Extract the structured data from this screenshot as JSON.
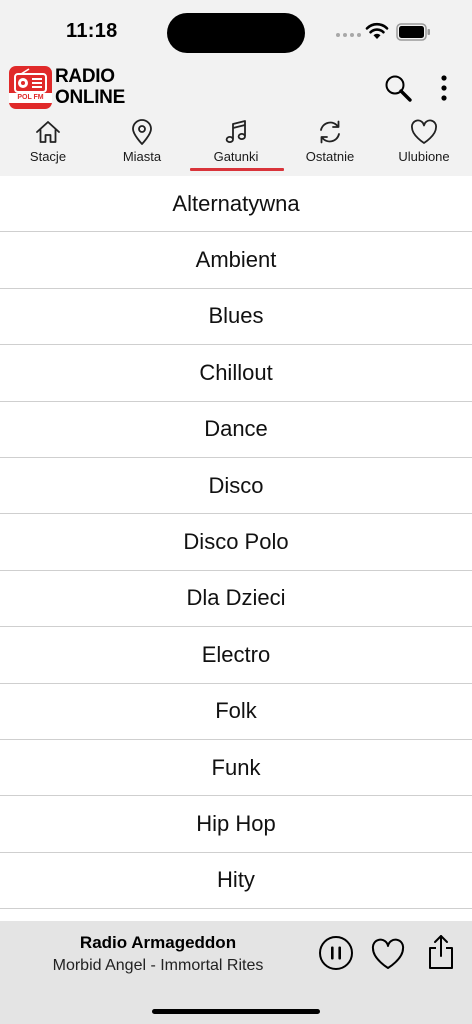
{
  "status_bar": {
    "time": "11:18"
  },
  "header": {
    "logo_line1": "RADIO",
    "logo_line2": "ONLINE",
    "logo_badge": "POL FM",
    "accent_color": "#e02a2a"
  },
  "tabs": [
    {
      "label": "Stacje",
      "icon": "home-icon",
      "active": false
    },
    {
      "label": "Miasta",
      "icon": "location-pin-icon",
      "active": false
    },
    {
      "label": "Gatunki",
      "icon": "music-note-icon",
      "active": true
    },
    {
      "label": "Ostatnie",
      "icon": "refresh-icon",
      "active": false
    },
    {
      "label": "Ulubione",
      "icon": "heart-icon",
      "active": false
    }
  ],
  "genres": [
    "Alternatywna",
    "Ambient",
    "Blues",
    "Chillout",
    "Dance",
    "Disco",
    "Disco Polo",
    "Dla Dzieci",
    "Electro",
    "Folk",
    "Funk",
    "Hip Hop",
    "Hity"
  ],
  "player": {
    "station": "Radio Armageddon",
    "track": "Morbid Angel - Immortal Rites",
    "state": "playing"
  }
}
